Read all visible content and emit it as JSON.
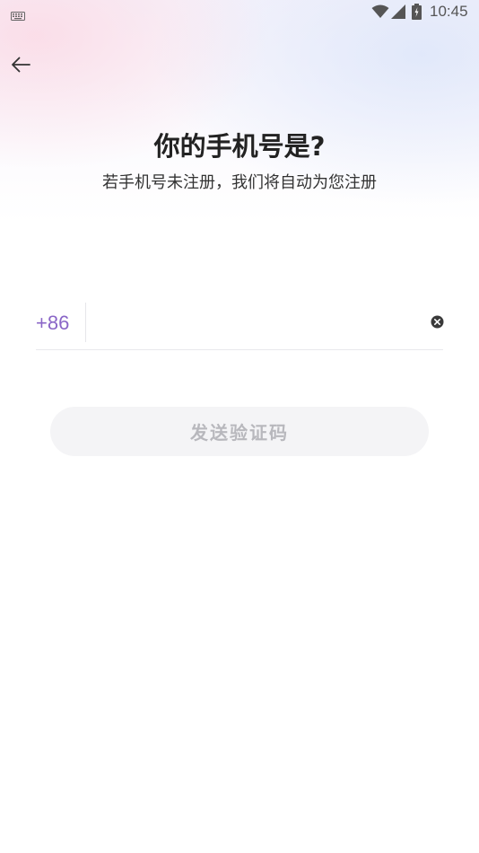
{
  "status_bar": {
    "time": "10:45",
    "icons": [
      "keyboard-icon",
      "wifi-icon",
      "signal-icon",
      "battery-icon"
    ]
  },
  "nav": {
    "back_icon": "arrow-left-icon"
  },
  "heading": {
    "title": "你的手机号是?",
    "subtitle": "若手机号未注册，我们将自动为您注册"
  },
  "phone": {
    "country_code": "+86",
    "value": "",
    "placeholder": "",
    "clear_icon": "clear-circle-icon"
  },
  "actions": {
    "send_code_label": "发送验证码",
    "send_code_enabled": false
  },
  "colors": {
    "accent": "#8a66c7",
    "button_bg": "#f4f4f6",
    "button_text_disabled": "#b8b8bd",
    "title": "#222222"
  }
}
